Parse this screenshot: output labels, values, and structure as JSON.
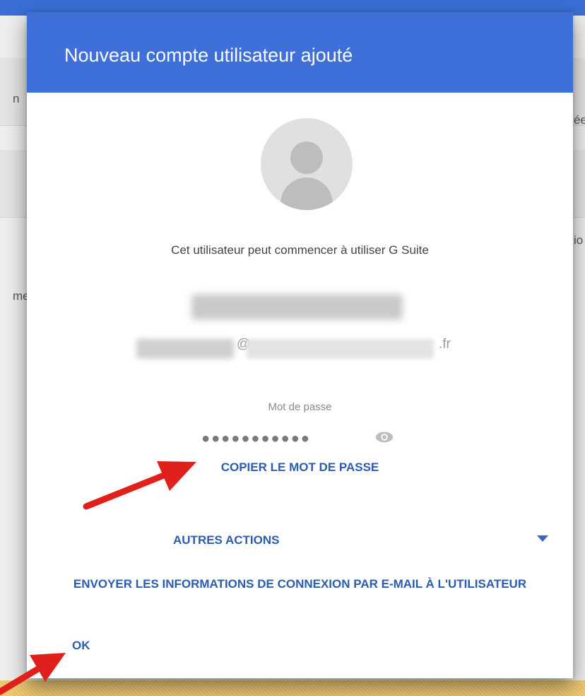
{
  "dialog": {
    "title": "Nouveau compte utilisateur ajouté",
    "status_text": "Cet utilisateur peut commencer à utiliser G Suite",
    "email": {
      "at_sign": "@",
      "tld": ".fr"
    },
    "password": {
      "label": "Mot de passe",
      "masked_value": "●●●●●●●●●●●",
      "toggle_icon": "eye-icon"
    },
    "copy_password_label": "COPIER LE MOT DE PASSE",
    "more_actions": {
      "label": "AUTRES ACTIONS",
      "icon": "dropdown-arrow-icon"
    },
    "send_info_label": "ENVOYER LES INFORMATIONS DE CONNEXION PAR E-MAIL À L'UTILISATEUR",
    "ok_label": "OK"
  },
  "background": {
    "left_fragments": [
      "n",
      "me"
    ],
    "right_fragments": [
      "ée",
      "io"
    ]
  },
  "colors": {
    "header": "#3f6fd9",
    "link": "#2a5cb0",
    "annotation_arrow": "#e0201b",
    "slide_background": "#f1c86f"
  }
}
